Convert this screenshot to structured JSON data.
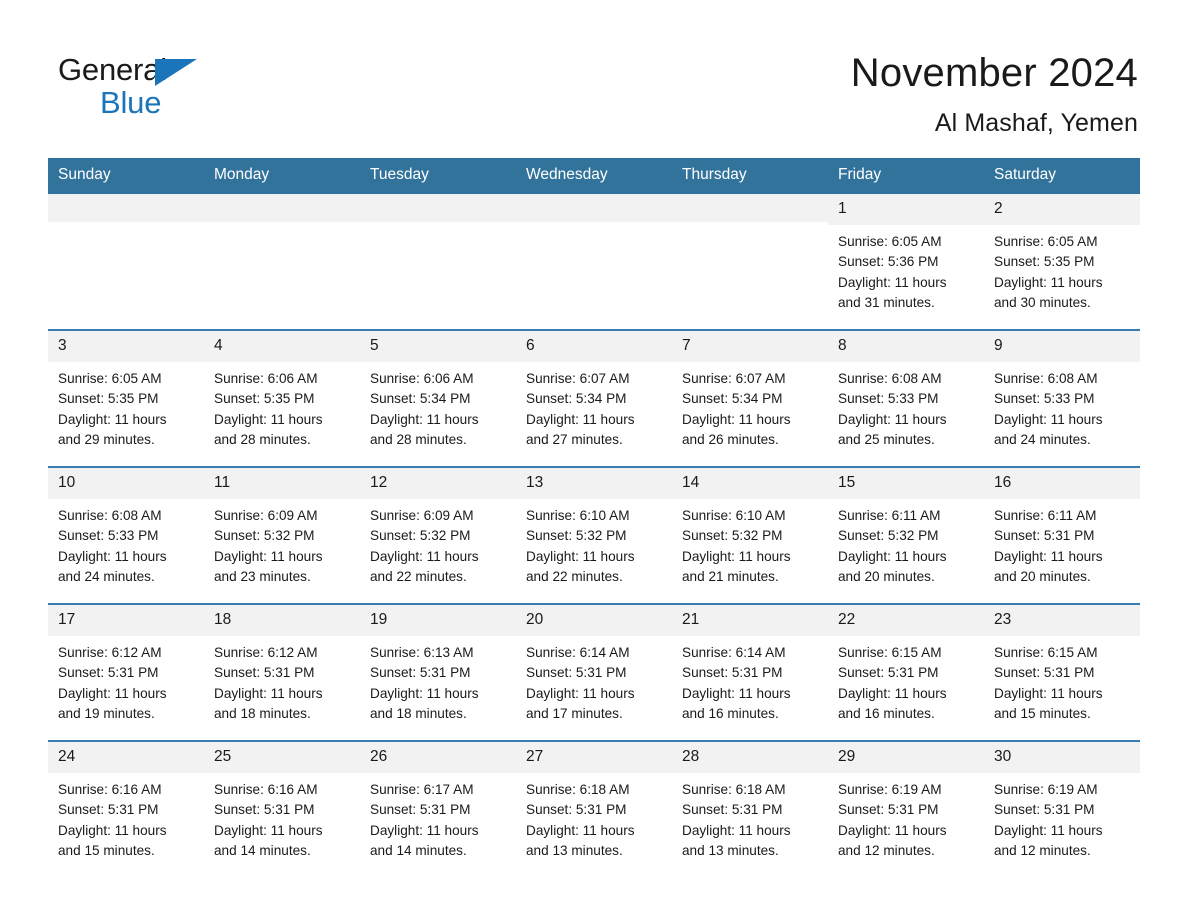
{
  "brand": {
    "line1": "General",
    "line2": "Blue",
    "flag_icon": "triangle-flag-icon",
    "accent_color": "#1b75bb"
  },
  "header": {
    "title": "November 2024",
    "subtitle": "Al Mashaf, Yemen"
  },
  "colors": {
    "header_row_bg": "#32739c",
    "week_divider": "#3a7cb0",
    "day_number_bg": "#f2f2f2",
    "text": "#1a1a1a"
  },
  "weekdays": [
    "Sunday",
    "Monday",
    "Tuesday",
    "Wednesday",
    "Thursday",
    "Friday",
    "Saturday"
  ],
  "weeks": [
    [
      {
        "day": "",
        "sunrise": "",
        "sunset": "",
        "daylight1": "",
        "daylight2": "",
        "empty": true
      },
      {
        "day": "",
        "sunrise": "",
        "sunset": "",
        "daylight1": "",
        "daylight2": "",
        "empty": true
      },
      {
        "day": "",
        "sunrise": "",
        "sunset": "",
        "daylight1": "",
        "daylight2": "",
        "empty": true
      },
      {
        "day": "",
        "sunrise": "",
        "sunset": "",
        "daylight1": "",
        "daylight2": "",
        "empty": true
      },
      {
        "day": "",
        "sunrise": "",
        "sunset": "",
        "daylight1": "",
        "daylight2": "",
        "empty": true
      },
      {
        "day": "1",
        "sunrise": "Sunrise: 6:05 AM",
        "sunset": "Sunset: 5:36 PM",
        "daylight1": "Daylight: 11 hours",
        "daylight2": "and 31 minutes.",
        "empty": false
      },
      {
        "day": "2",
        "sunrise": "Sunrise: 6:05 AM",
        "sunset": "Sunset: 5:35 PM",
        "daylight1": "Daylight: 11 hours",
        "daylight2": "and 30 minutes.",
        "empty": false
      }
    ],
    [
      {
        "day": "3",
        "sunrise": "Sunrise: 6:05 AM",
        "sunset": "Sunset: 5:35 PM",
        "daylight1": "Daylight: 11 hours",
        "daylight2": "and 29 minutes.",
        "empty": false
      },
      {
        "day": "4",
        "sunrise": "Sunrise: 6:06 AM",
        "sunset": "Sunset: 5:35 PM",
        "daylight1": "Daylight: 11 hours",
        "daylight2": "and 28 minutes.",
        "empty": false
      },
      {
        "day": "5",
        "sunrise": "Sunrise: 6:06 AM",
        "sunset": "Sunset: 5:34 PM",
        "daylight1": "Daylight: 11 hours",
        "daylight2": "and 28 minutes.",
        "empty": false
      },
      {
        "day": "6",
        "sunrise": "Sunrise: 6:07 AM",
        "sunset": "Sunset: 5:34 PM",
        "daylight1": "Daylight: 11 hours",
        "daylight2": "and 27 minutes.",
        "empty": false
      },
      {
        "day": "7",
        "sunrise": "Sunrise: 6:07 AM",
        "sunset": "Sunset: 5:34 PM",
        "daylight1": "Daylight: 11 hours",
        "daylight2": "and 26 minutes.",
        "empty": false
      },
      {
        "day": "8",
        "sunrise": "Sunrise: 6:08 AM",
        "sunset": "Sunset: 5:33 PM",
        "daylight1": "Daylight: 11 hours",
        "daylight2": "and 25 minutes.",
        "empty": false
      },
      {
        "day": "9",
        "sunrise": "Sunrise: 6:08 AM",
        "sunset": "Sunset: 5:33 PM",
        "daylight1": "Daylight: 11 hours",
        "daylight2": "and 24 minutes.",
        "empty": false
      }
    ],
    [
      {
        "day": "10",
        "sunrise": "Sunrise: 6:08 AM",
        "sunset": "Sunset: 5:33 PM",
        "daylight1": "Daylight: 11 hours",
        "daylight2": "and 24 minutes.",
        "empty": false
      },
      {
        "day": "11",
        "sunrise": "Sunrise: 6:09 AM",
        "sunset": "Sunset: 5:32 PM",
        "daylight1": "Daylight: 11 hours",
        "daylight2": "and 23 minutes.",
        "empty": false
      },
      {
        "day": "12",
        "sunrise": "Sunrise: 6:09 AM",
        "sunset": "Sunset: 5:32 PM",
        "daylight1": "Daylight: 11 hours",
        "daylight2": "and 22 minutes.",
        "empty": false
      },
      {
        "day": "13",
        "sunrise": "Sunrise: 6:10 AM",
        "sunset": "Sunset: 5:32 PM",
        "daylight1": "Daylight: 11 hours",
        "daylight2": "and 22 minutes.",
        "empty": false
      },
      {
        "day": "14",
        "sunrise": "Sunrise: 6:10 AM",
        "sunset": "Sunset: 5:32 PM",
        "daylight1": "Daylight: 11 hours",
        "daylight2": "and 21 minutes.",
        "empty": false
      },
      {
        "day": "15",
        "sunrise": "Sunrise: 6:11 AM",
        "sunset": "Sunset: 5:32 PM",
        "daylight1": "Daylight: 11 hours",
        "daylight2": "and 20 minutes.",
        "empty": false
      },
      {
        "day": "16",
        "sunrise": "Sunrise: 6:11 AM",
        "sunset": "Sunset: 5:31 PM",
        "daylight1": "Daylight: 11 hours",
        "daylight2": "and 20 minutes.",
        "empty": false
      }
    ],
    [
      {
        "day": "17",
        "sunrise": "Sunrise: 6:12 AM",
        "sunset": "Sunset: 5:31 PM",
        "daylight1": "Daylight: 11 hours",
        "daylight2": "and 19 minutes.",
        "empty": false
      },
      {
        "day": "18",
        "sunrise": "Sunrise: 6:12 AM",
        "sunset": "Sunset: 5:31 PM",
        "daylight1": "Daylight: 11 hours",
        "daylight2": "and 18 minutes.",
        "empty": false
      },
      {
        "day": "19",
        "sunrise": "Sunrise: 6:13 AM",
        "sunset": "Sunset: 5:31 PM",
        "daylight1": "Daylight: 11 hours",
        "daylight2": "and 18 minutes.",
        "empty": false
      },
      {
        "day": "20",
        "sunrise": "Sunrise: 6:14 AM",
        "sunset": "Sunset: 5:31 PM",
        "daylight1": "Daylight: 11 hours",
        "daylight2": "and 17 minutes.",
        "empty": false
      },
      {
        "day": "21",
        "sunrise": "Sunrise: 6:14 AM",
        "sunset": "Sunset: 5:31 PM",
        "daylight1": "Daylight: 11 hours",
        "daylight2": "and 16 minutes.",
        "empty": false
      },
      {
        "day": "22",
        "sunrise": "Sunrise: 6:15 AM",
        "sunset": "Sunset: 5:31 PM",
        "daylight1": "Daylight: 11 hours",
        "daylight2": "and 16 minutes.",
        "empty": false
      },
      {
        "day": "23",
        "sunrise": "Sunrise: 6:15 AM",
        "sunset": "Sunset: 5:31 PM",
        "daylight1": "Daylight: 11 hours",
        "daylight2": "and 15 minutes.",
        "empty": false
      }
    ],
    [
      {
        "day": "24",
        "sunrise": "Sunrise: 6:16 AM",
        "sunset": "Sunset: 5:31 PM",
        "daylight1": "Daylight: 11 hours",
        "daylight2": "and 15 minutes.",
        "empty": false
      },
      {
        "day": "25",
        "sunrise": "Sunrise: 6:16 AM",
        "sunset": "Sunset: 5:31 PM",
        "daylight1": "Daylight: 11 hours",
        "daylight2": "and 14 minutes.",
        "empty": false
      },
      {
        "day": "26",
        "sunrise": "Sunrise: 6:17 AM",
        "sunset": "Sunset: 5:31 PM",
        "daylight1": "Daylight: 11 hours",
        "daylight2": "and 14 minutes.",
        "empty": false
      },
      {
        "day": "27",
        "sunrise": "Sunrise: 6:18 AM",
        "sunset": "Sunset: 5:31 PM",
        "daylight1": "Daylight: 11 hours",
        "daylight2": "and 13 minutes.",
        "empty": false
      },
      {
        "day": "28",
        "sunrise": "Sunrise: 6:18 AM",
        "sunset": "Sunset: 5:31 PM",
        "daylight1": "Daylight: 11 hours",
        "daylight2": "and 13 minutes.",
        "empty": false
      },
      {
        "day": "29",
        "sunrise": "Sunrise: 6:19 AM",
        "sunset": "Sunset: 5:31 PM",
        "daylight1": "Daylight: 11 hours",
        "daylight2": "and 12 minutes.",
        "empty": false
      },
      {
        "day": "30",
        "sunrise": "Sunrise: 6:19 AM",
        "sunset": "Sunset: 5:31 PM",
        "daylight1": "Daylight: 11 hours",
        "daylight2": "and 12 minutes.",
        "empty": false
      }
    ]
  ]
}
